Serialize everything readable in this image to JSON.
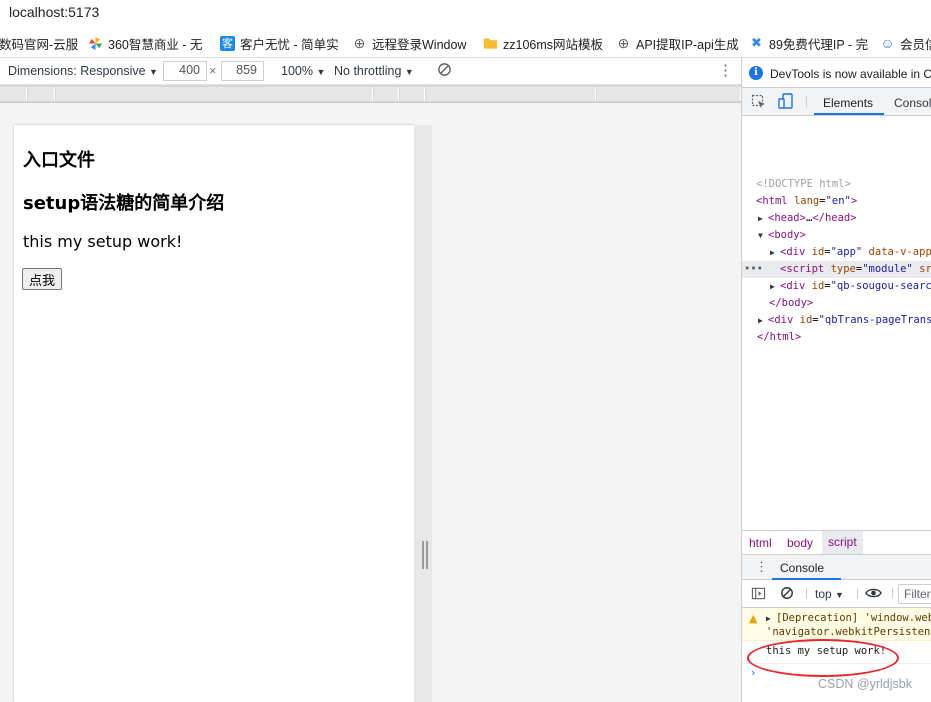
{
  "address_bar": {
    "url": "localhost:5173"
  },
  "bookmarks": [
    {
      "label": "数码官网-云服",
      "icon": "none"
    },
    {
      "label": "360智慧商业 - 无",
      "icon": "pinwheel-icon",
      "color": "#f4b400"
    },
    {
      "label": "客户无忧 - 简单实",
      "icon": "kehu-icon",
      "glyph": "客",
      "color": "#1e88e5"
    },
    {
      "label": "远程登录Window",
      "icon": "globe-icon",
      "glyph": "⊕",
      "color": "#5f6368"
    },
    {
      "label": "zz106ms网站模板",
      "icon": "folder-icon",
      "color": "#f9bb2d"
    },
    {
      "label": "API提取IP-api生成",
      "icon": "globe-icon",
      "glyph": "⊕",
      "color": "#5f6368"
    },
    {
      "label": "89免费代理IP - 完",
      "icon": "cross-icon",
      "glyph": "✖",
      "color": "#2d8cf0"
    },
    {
      "label": "会员信",
      "icon": "user-icon",
      "glyph": "☺",
      "color": "#3b78c2"
    }
  ],
  "device_toolbar": {
    "dimensions": "Dimensions: Responsive",
    "width": "400",
    "times": "×",
    "height": "859",
    "zoom": "100%",
    "throttling": "No throttling"
  },
  "page": {
    "h1": "入口文件",
    "h2": "setup语法糖的简单介绍",
    "paragraph": "this my setup work!",
    "button_label": "点我"
  },
  "devtools": {
    "notice": "DevTools is now available in Chinese",
    "tabs": [
      "Elements",
      "Console"
    ],
    "dom": {
      "doctype": "<!DOCTYPE html>",
      "html_open_tag": "html",
      "html_attr": "lang",
      "html_attr_val": "\"en\"",
      "head": "head",
      "head_ellipsis": "…",
      "body": "body",
      "div_app_id": "\"app\"",
      "div_app_extra": "data-v-app",
      "script_attr": "type",
      "script_val": "\"module\"",
      "script_extra": "src",
      "div_sougou_id": "\"qb-sougou-search\"",
      "body_close": "</body>",
      "div_trans_id": "\"qbTrans-pageTrans\"",
      "html_close": "</html>",
      "div": "div",
      "id": "id",
      "script": "script"
    },
    "breadcrumbs": [
      "html",
      "body",
      "script"
    ],
    "console": {
      "tab": "Console",
      "context": "top",
      "filter": "Filter",
      "warning_line1": "[Deprecation] 'window.webkitStorageInfo'",
      "warning_line2": "'navigator.webkitPersistentStorage'",
      "log_message": "this my setup work!",
      "prompt": "›"
    }
  },
  "watermark": "CSDN @yrldjsbk"
}
